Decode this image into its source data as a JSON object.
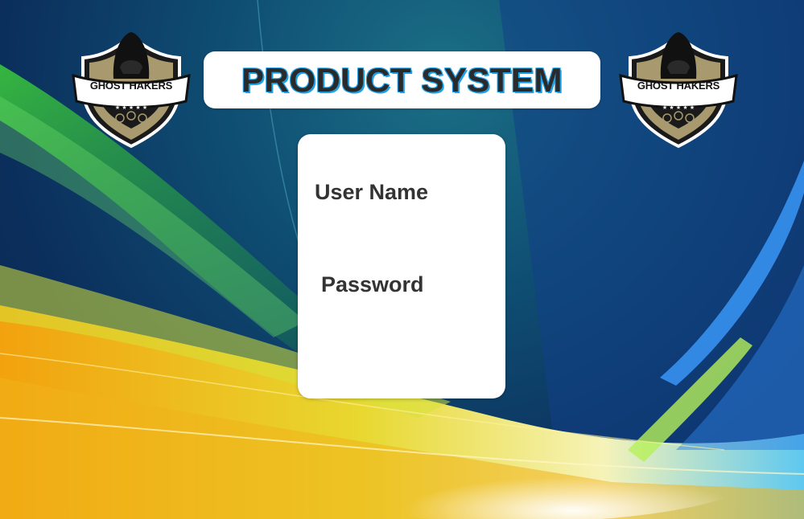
{
  "header": {
    "title": "PRODUCT SYSTEM"
  },
  "logos": {
    "left_text": "GHOST HAKERS",
    "right_text": "GHOST HAKERS"
  },
  "login": {
    "username_label": "User Name",
    "password_label": "Password"
  },
  "colors": {
    "title_outline": "#1ea0e6",
    "card_background": "#ffffff",
    "logo_gold": "#a89a6e"
  },
  "icons": {
    "logo": "hooded-figure-shield-icon"
  }
}
